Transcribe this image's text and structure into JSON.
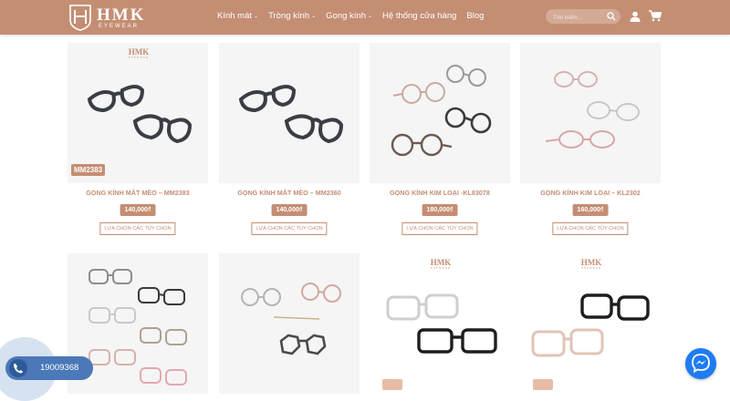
{
  "header": {
    "logo_text": "HMK",
    "logo_sub": "EYEWEAR",
    "nav": [
      {
        "label": "Kính mát",
        "has_dropdown": true
      },
      {
        "label": "Tròng kính",
        "has_dropdown": true
      },
      {
        "label": "Gọng kính",
        "has_dropdown": true
      },
      {
        "label": "Hệ thống cửa hàng",
        "has_dropdown": false
      },
      {
        "label": "Blog",
        "has_dropdown": false
      }
    ],
    "search_placeholder": "Tìm kiếm...",
    "icons": [
      "search-icon",
      "user-icon",
      "cart-icon"
    ]
  },
  "products": [
    {
      "title": "GỌNG KÍNH MẮT MÈO – MM2383",
      "price": "140,000₫",
      "option_label": "LỰA CHỌN CÁC TÙY CHỌN",
      "tag": "MM2383",
      "brand": "HMK"
    },
    {
      "title": "GỌNG KÍNH MẮT MÈO – MM2360",
      "price": "140,000₫",
      "option_label": "LỰA CHỌN CÁC TÙY CHỌN"
    },
    {
      "title": "GỌNG KÍNH KIM LOẠI -KL83078",
      "price": "180,000₫",
      "option_label": "LỰA CHỌN CÁC TÙY CHỌN"
    },
    {
      "title": "GỌNG KÍNH KIM LOẠI – KL2302",
      "price": "160,000₫",
      "option_label": "LỰA CHỌN CÁC TÙY CHỌN"
    }
  ],
  "second_row_brands": [
    "HMK",
    "HMK"
  ],
  "contact": {
    "phone": "19009368"
  },
  "colors": {
    "brand": "#c48e73",
    "call": "#4a78b8",
    "messenger": "#1e7bf2"
  }
}
